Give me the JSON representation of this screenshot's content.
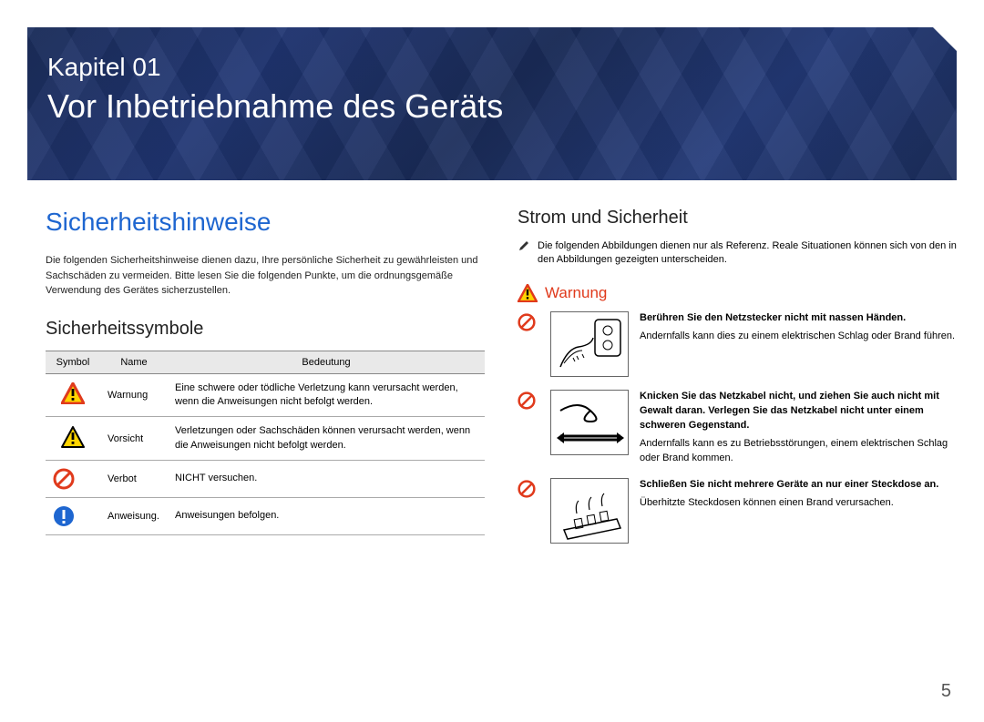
{
  "banner": {
    "chapter_label": "Kapitel 01",
    "chapter_title": "Vor Inbetriebnahme des Geräts"
  },
  "left": {
    "section_heading": "Sicherheitshinweise",
    "intro_text": "Die folgenden Sicherheitshinweise dienen dazu, Ihre persönliche Sicherheit zu gewährleisten und Sachschäden zu vermeiden. Bitte lesen Sie die folgenden Punkte, um die ordnungsgemäße Verwendung des Gerätes sicherzustellen.",
    "symbols_heading": "Sicherheitssymbole",
    "table": {
      "headers": {
        "symbol": "Symbol",
        "name": "Name",
        "meaning": "Bedeutung"
      },
      "rows": [
        {
          "icon": "warning-red-triangle-icon",
          "name": "Warnung",
          "meaning": "Eine schwere oder tödliche Verletzung kann verursacht werden, wenn die Anweisungen nicht befolgt werden."
        },
        {
          "icon": "caution-yellow-triangle-icon",
          "name": "Vorsicht",
          "meaning": "Verletzungen oder Sachschäden können verursacht werden, wenn die Anweisungen nicht befolgt werden."
        },
        {
          "icon": "prohibit-red-circle-icon",
          "name": "Verbot",
          "meaning": "NICHT versuchen."
        },
        {
          "icon": "instruction-blue-circle-icon",
          "name": "Anweisung.",
          "meaning": "Anweisungen befolgen."
        }
      ]
    }
  },
  "right": {
    "section_heading": "Strom und Sicherheit",
    "note_text": "Die folgenden Abbildungen dienen nur als Referenz. Reale Situationen können sich von den in den Abbildungen gezeigten unterscheiden.",
    "warning_title": "Warnung",
    "blocks": [
      {
        "bold": "Berühren Sie den Netzstecker nicht mit nassen Händen.",
        "body": "Andernfalls kann dies zu einem elektrischen Schlag oder Brand führen.",
        "illustration": "wet-hand-outlet-illustration"
      },
      {
        "bold": "Knicken Sie das Netzkabel nicht, und ziehen Sie auch nicht mit Gewalt daran. Verlegen Sie das Netzkabel nicht unter einem schweren Gegenstand.",
        "body": "Andernfalls kann es zu Betriebsstörungen, einem elektrischen Schlag oder Brand kommen.",
        "illustration": "bent-cable-illustration"
      },
      {
        "bold": "Schließen Sie nicht mehrere Geräte an nur einer Steckdose an.",
        "body": "Überhitzte Steckdosen können einen Brand verursachen.",
        "illustration": "power-strip-fire-illustration"
      }
    ]
  },
  "page_number": "5"
}
